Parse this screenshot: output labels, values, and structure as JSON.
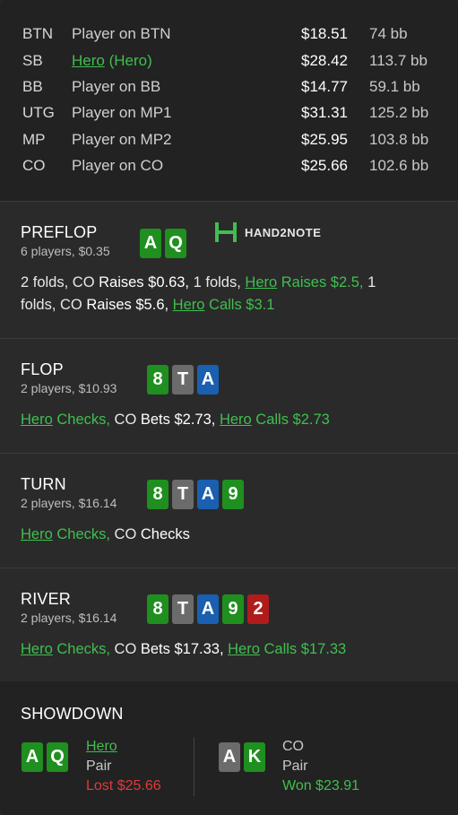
{
  "players": [
    {
      "pos": "BTN",
      "name": "Player on BTN",
      "stack": "$18.51",
      "bb": "74 bb"
    },
    {
      "pos": "SB",
      "name": "Hero",
      "tag": "(Hero)",
      "stack": "$28.42",
      "bb": "113.7 bb"
    },
    {
      "pos": "BB",
      "name": "Player on BB",
      "stack": "$14.77",
      "bb": "59.1 bb"
    },
    {
      "pos": "UTG",
      "name": "Player on MP1",
      "stack": "$31.31",
      "bb": "125.2 bb"
    },
    {
      "pos": "MP",
      "name": "Player on MP2",
      "stack": "$25.95",
      "bb": "103.8 bb"
    },
    {
      "pos": "CO",
      "name": "Player on CO",
      "stack": "$25.66",
      "bb": "102.6 bb"
    }
  ],
  "logo": {
    "text": "HAND2NOTE"
  },
  "preflop": {
    "title": "PREFLOP",
    "sub": "6 players, $0.35",
    "cards": [
      {
        "rank": "A",
        "color": "green"
      },
      {
        "rank": "Q",
        "color": "green"
      }
    ],
    "a1": "2 folds, CO ",
    "a2": "Raises $0.63,",
    "a3": " 1 folds, ",
    "a4": "Hero",
    "a5": " Raises $2.5,",
    "a6": " 1",
    "b1": "folds, CO ",
    "b2": "Raises $5.6,",
    "b3": " ",
    "b4": "Hero",
    "b5": " Calls $3.1"
  },
  "flop": {
    "title": "FLOP",
    "sub": "2 players, $10.93",
    "cards": [
      {
        "rank": "8",
        "color": "green"
      },
      {
        "rank": "T",
        "color": "grey"
      },
      {
        "rank": "A",
        "color": "blue"
      }
    ],
    "a1": "Hero",
    "a2": " Checks,",
    "a3": " CO ",
    "a4": "Bets $2.73,",
    "a5": " ",
    "a6": "Hero",
    "a7": " Calls $2.73"
  },
  "turn": {
    "title": "TURN",
    "sub": "2 players, $16.14",
    "cards": [
      {
        "rank": "8",
        "color": "green"
      },
      {
        "rank": "T",
        "color": "grey"
      },
      {
        "rank": "A",
        "color": "blue"
      },
      {
        "rank": "9",
        "color": "green"
      }
    ],
    "a1": "Hero",
    "a2": " Checks,",
    "a3": " CO ",
    "a4": "Checks"
  },
  "river": {
    "title": "RIVER",
    "sub": "2 players, $16.14",
    "cards": [
      {
        "rank": "8",
        "color": "green"
      },
      {
        "rank": "T",
        "color": "grey"
      },
      {
        "rank": "A",
        "color": "blue"
      },
      {
        "rank": "9",
        "color": "green"
      },
      {
        "rank": "2",
        "color": "red"
      }
    ],
    "a1": "Hero",
    "a2": " Checks,",
    "a3": " CO ",
    "a4": "Bets $17.33,",
    "a5": " ",
    "a6": "Hero",
    "a7": " Calls $17.33"
  },
  "showdown": {
    "title": "SHOWDOWN",
    "left": {
      "cards": [
        {
          "rank": "A",
          "color": "green"
        },
        {
          "rank": "Q",
          "color": "green"
        }
      ],
      "name": "Hero",
      "hand": "Pair",
      "result": "Lost $25.66"
    },
    "right": {
      "cards": [
        {
          "rank": "A",
          "color": "grey"
        },
        {
          "rank": "K",
          "color": "green"
        }
      ],
      "name": "CO",
      "hand": "Pair",
      "result": "Won $23.91"
    }
  },
  "colors": {
    "green": "#1f8f1f",
    "grey": "#6b6b6b",
    "blue": "#1a5fb0",
    "red": "#b01c1c",
    "accent": "#3fbf4f",
    "loss": "#e03a3a"
  }
}
